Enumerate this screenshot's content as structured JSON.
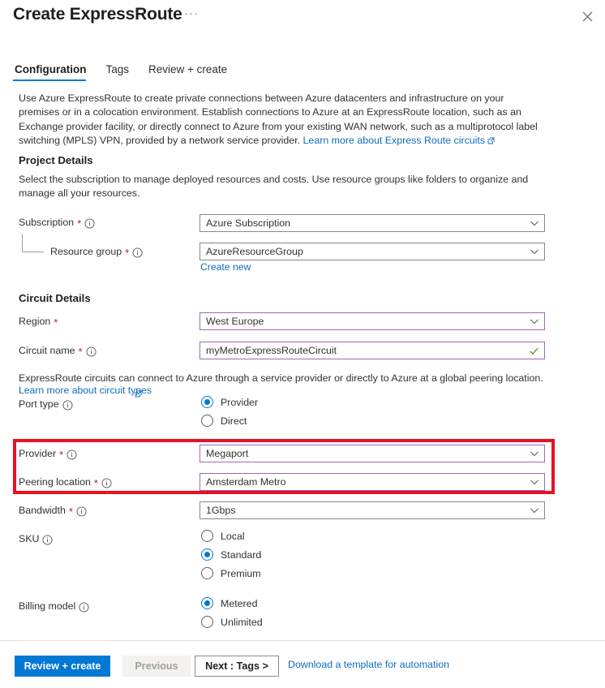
{
  "window": {
    "title": "Create ExpressRoute",
    "ellipsis": "···",
    "close_icon": "close-icon"
  },
  "tabs": [
    {
      "label": "Configuration",
      "active": true
    },
    {
      "label": "Tags",
      "active": false
    },
    {
      "label": "Review + create",
      "active": false
    }
  ],
  "intro": {
    "text": "Use Azure ExpressRoute to create private connections between Azure datacenters and infrastructure on your premises or in a colocation environment. Establish connections to Azure at an ExpressRoute location, such as an Exchange provider facility, or directly connect to Azure from your existing WAN network, such as a multiprotocol label switching (MPLS) VPN, provided by a network service provider. ",
    "link_label": "Learn more about Express Route circuits"
  },
  "project_details": {
    "heading": "Project Details",
    "helper": "Select the subscription to manage deployed resources and costs. Use resource groups like folders to organize and manage all your resources.",
    "subscription": {
      "label": "Subscription",
      "required": "*",
      "value": "Azure Subscription"
    },
    "resource_group": {
      "label": "Resource group",
      "required": "*",
      "value": "AzureResourceGroup",
      "create_new_label": "Create new"
    }
  },
  "circuit_details": {
    "heading": "Circuit Details",
    "region": {
      "label": "Region",
      "required": "*",
      "value": "West Europe"
    },
    "circuit_name": {
      "label": "Circuit name",
      "required": "*",
      "value": "myMetroExpressRouteCircuit"
    },
    "port_type_note": "ExpressRoute circuits can connect to Azure through a service provider or directly to Azure at a global peering location.",
    "port_type_link": "Learn more about circuit types",
    "port_type": {
      "label": "Port type",
      "options": [
        {
          "label": "Provider",
          "selected": true
        },
        {
          "label": "Direct",
          "selected": false
        }
      ]
    },
    "provider": {
      "label": "Provider",
      "required": "*",
      "value": "Megaport"
    },
    "peering_location": {
      "label": "Peering location",
      "required": "*",
      "value": "Amsterdam Metro"
    },
    "bandwidth": {
      "label": "Bandwidth",
      "required": "*",
      "value": "1Gbps"
    },
    "sku": {
      "label": "SKU",
      "options": [
        {
          "label": "Local",
          "selected": false
        },
        {
          "label": "Standard",
          "selected": true
        },
        {
          "label": "Premium",
          "selected": false
        }
      ]
    },
    "billing_model": {
      "label": "Billing model",
      "options": [
        {
          "label": "Metered",
          "selected": true
        },
        {
          "label": "Unlimited",
          "selected": false
        }
      ]
    }
  },
  "footer": {
    "review_create": "Review + create",
    "previous": "Previous",
    "next": "Next : Tags >",
    "download_template": "Download a template for automation"
  },
  "colors": {
    "accent": "#0078d4",
    "link": "#0f6cbd",
    "required_asterisk": "#a4262c",
    "highlight_box": "#e81123",
    "focused_field_border": "#9b6ab5",
    "valid_check": "#498205"
  }
}
